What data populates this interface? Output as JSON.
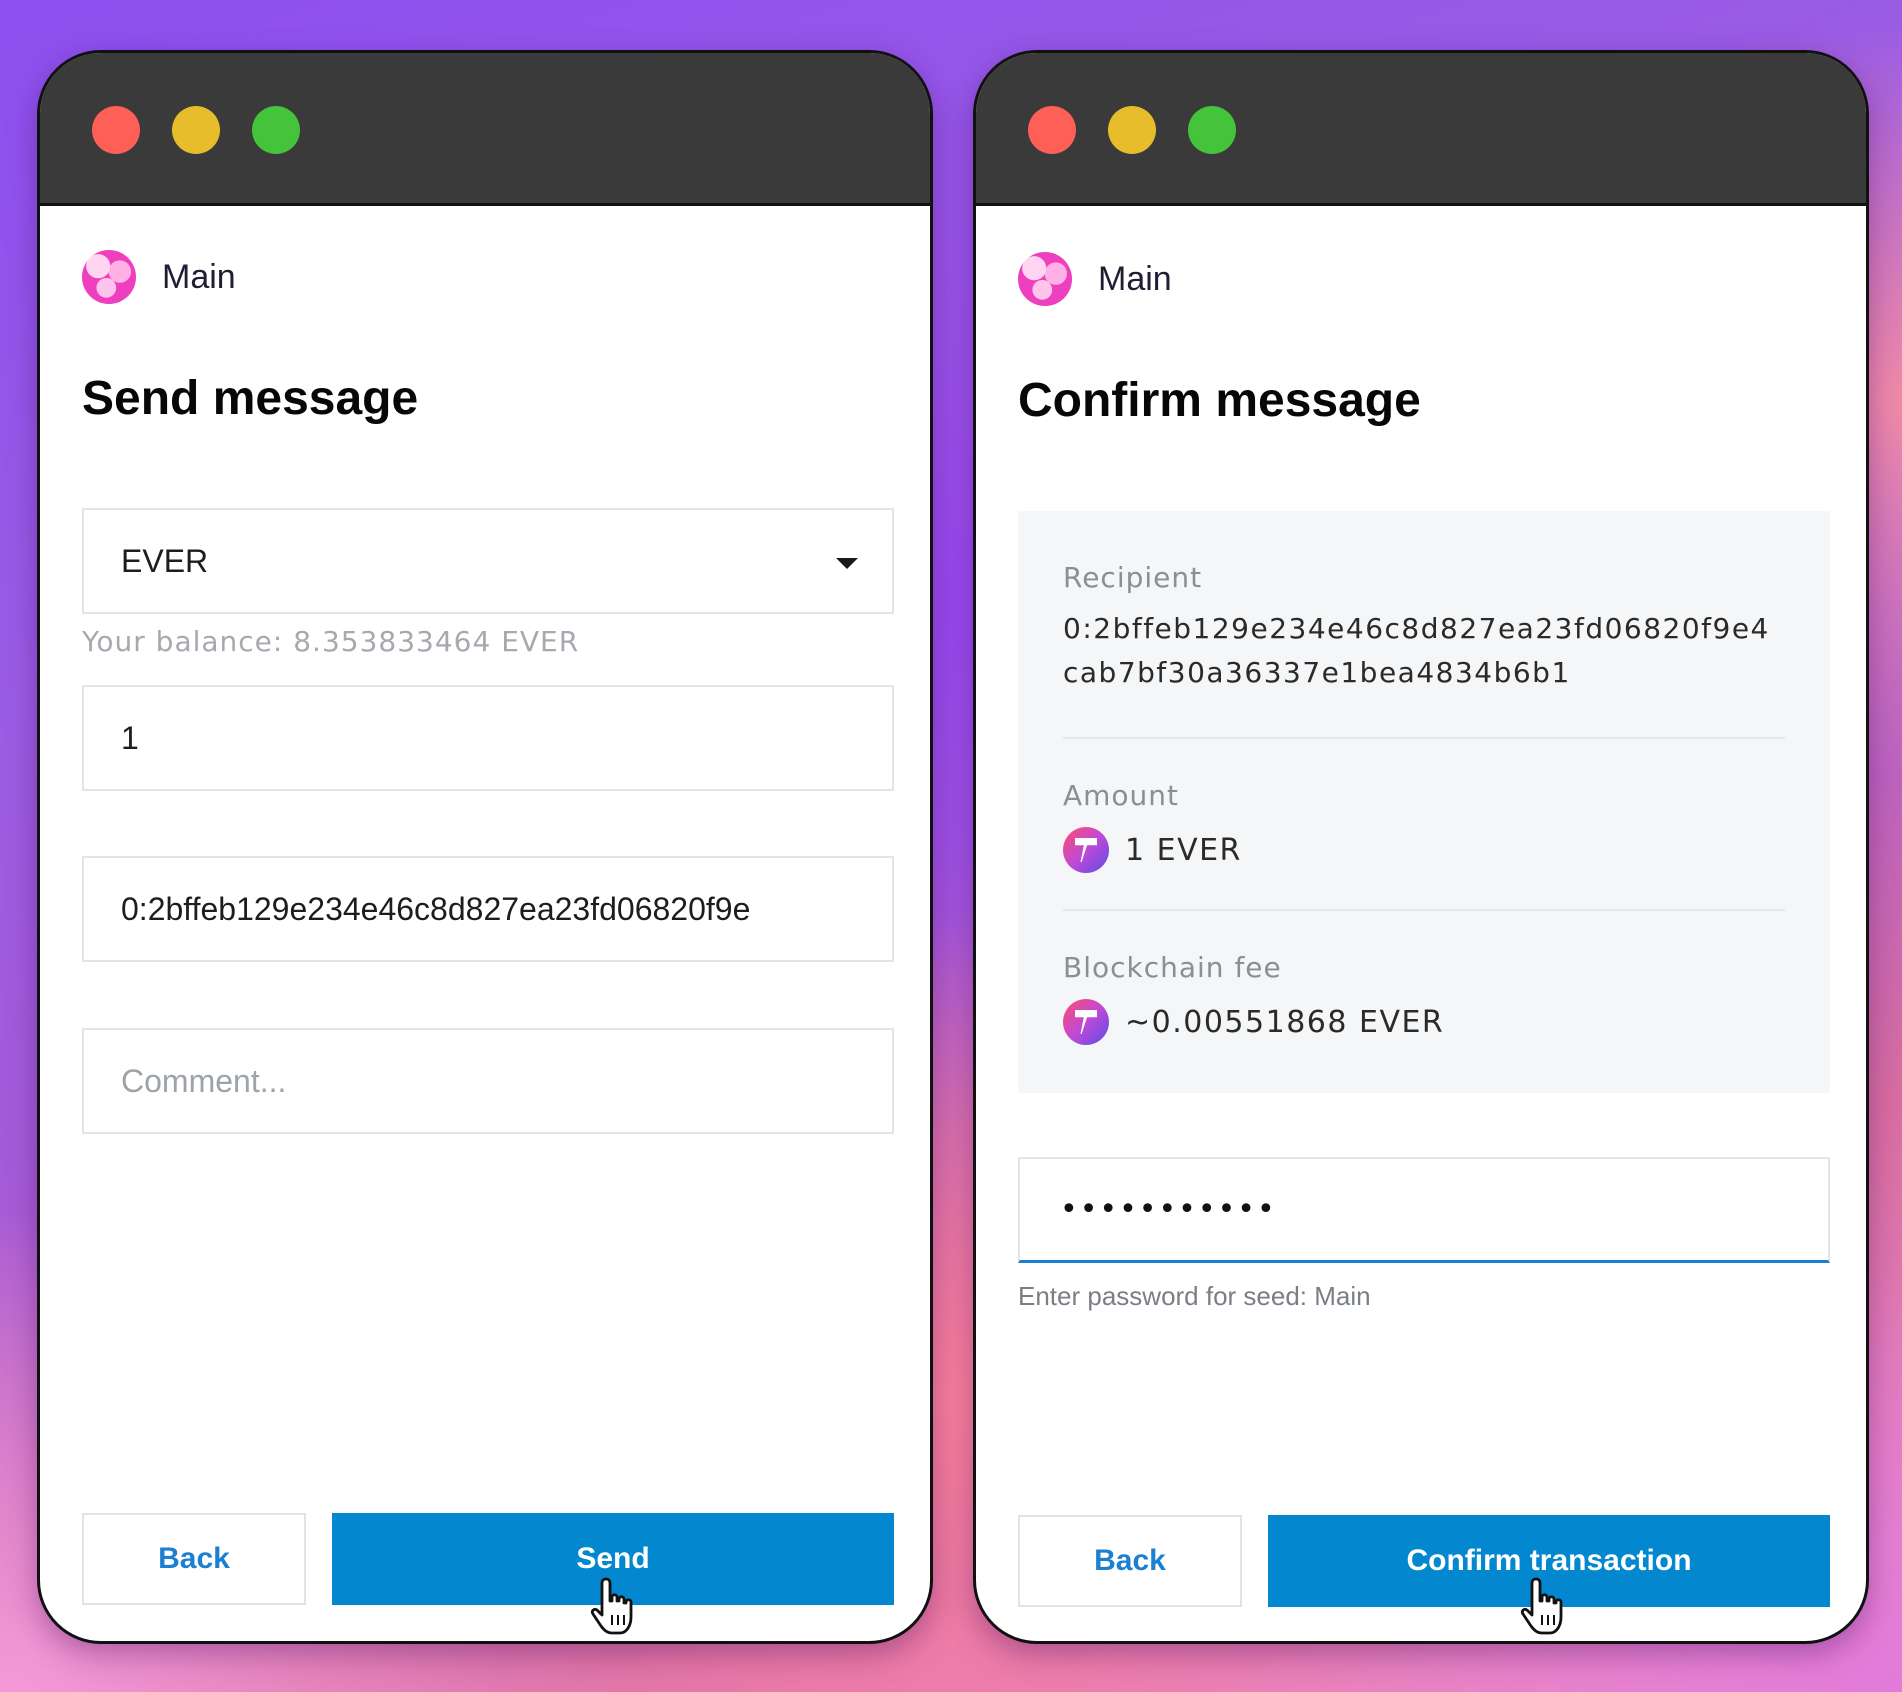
{
  "send_window": {
    "account_name": "Main",
    "title": "Send message",
    "token_select": {
      "value": "EVER"
    },
    "balance_text": "Your balance: 8.353833464 EVER",
    "amount_value": "1",
    "recipient_value": "0:2bffeb129e234e46c8d827ea23fd06820f9e",
    "comment_placeholder": "Comment...",
    "back_label": "Back",
    "send_label": "Send"
  },
  "confirm_window": {
    "account_name": "Main",
    "title": "Confirm message",
    "recipient_label": "Recipient",
    "recipient_value": "0:2bffeb129e234e46c8d827ea23fd06820f9e4cab7bf30a36337e1bea4834b6b1",
    "amount_label": "Amount",
    "amount_value": "1 EVER",
    "fee_label": "Blockchain fee",
    "fee_value": "~0.00551868 EVER",
    "password_value": "•••••••••••",
    "password_hint": "Enter password for seed: Main",
    "back_label": "Back",
    "confirm_label": "Confirm transaction"
  },
  "colors": {
    "primary_button": "#0388d0",
    "link_blue": "#1b7fd2",
    "window_close": "#fe5f57",
    "window_minimize": "#e8bd2b",
    "window_maximize": "#44c43a"
  },
  "icons": [
    "avatar",
    "dropdown-caret-icon",
    "ever-token-icon",
    "hand-pointer-cursor-icon"
  ]
}
